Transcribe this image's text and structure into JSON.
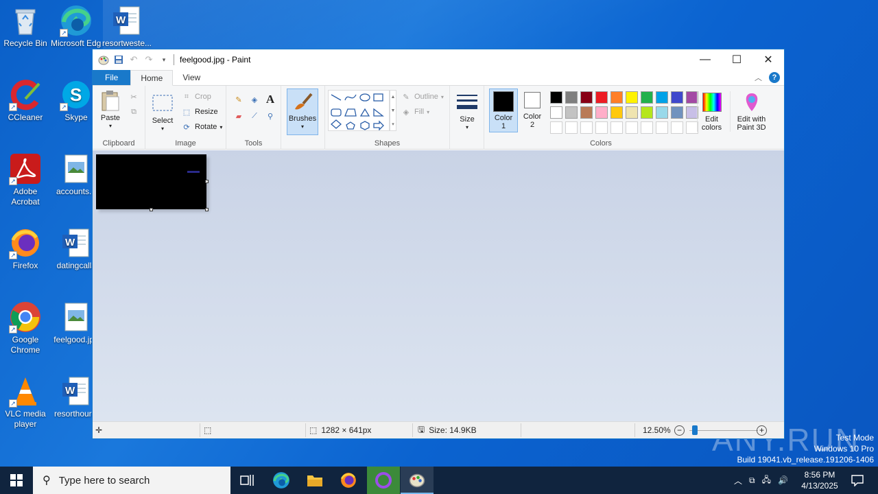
{
  "desktop": {
    "icons": [
      {
        "label": "Recycle Bin",
        "icon": "recycle-bin"
      },
      {
        "label": "Microsoft Edge",
        "icon": "edge"
      },
      {
        "label": "resortweste...",
        "icon": "word-doc"
      },
      {
        "label": "CCleaner",
        "icon": "ccleaner"
      },
      {
        "label": "Skype",
        "icon": "skype"
      },
      {
        "label": "Adobe Acrobat",
        "icon": "acrobat"
      },
      {
        "label": "accounts...",
        "icon": "image-file"
      },
      {
        "label": "Firefox",
        "icon": "firefox"
      },
      {
        "label": "datingcalls",
        "icon": "word-doc"
      },
      {
        "label": "Google Chrome",
        "icon": "chrome"
      },
      {
        "label": "feelgood.jpg",
        "icon": "image-file"
      },
      {
        "label": "VLC media player",
        "icon": "vlc"
      },
      {
        "label": "resorthour...",
        "icon": "word-doc"
      }
    ]
  },
  "paint": {
    "title": "feelgood.jpg - Paint",
    "tabs": {
      "file": "File",
      "home": "Home",
      "view": "View"
    },
    "clipboard": {
      "paste": "Paste",
      "group": "Clipboard"
    },
    "image": {
      "select": "Select",
      "crop": "Crop",
      "resize": "Resize",
      "rotate": "Rotate",
      "group": "Image"
    },
    "tools": {
      "group": "Tools",
      "brushes": "Brushes"
    },
    "shapes": {
      "outline": "Outline",
      "fill": "Fill",
      "group": "Shapes"
    },
    "size": {
      "label": "Size"
    },
    "colors": {
      "color1": "Color 1",
      "color2": "Color 2",
      "edit_colors": "Edit colors",
      "edit_paint3d": "Edit with Paint 3D",
      "group": "Colors",
      "color1_value": "#000000",
      "color2_value": "#ffffff",
      "palette_row1": [
        "#000000",
        "#7f7f7f",
        "#880015",
        "#ed1c24",
        "#ff7f27",
        "#fff200",
        "#22b14c",
        "#00a2e8",
        "#3f48cc",
        "#a349a4"
      ],
      "palette_row2": [
        "#ffffff",
        "#c3c3c3",
        "#b97a57",
        "#ffaec9",
        "#ffc90e",
        "#efe4b0",
        "#b5e61d",
        "#99d9ea",
        "#7092be",
        "#c8bfe7"
      ]
    },
    "status": {
      "dimensions": "1282 × 641px",
      "size": "Size: 14.9KB",
      "zoom": "12.50%"
    }
  },
  "taskbar": {
    "search_placeholder": "Type here to search",
    "time": "8:56 PM",
    "date": "4/13/2025"
  },
  "watermark": {
    "line1": "Test Mode",
    "line2": "Windows 10 Pro",
    "line3": "Build 19041.vb_release.191206-1406",
    "brand": "ANY.RUN"
  }
}
